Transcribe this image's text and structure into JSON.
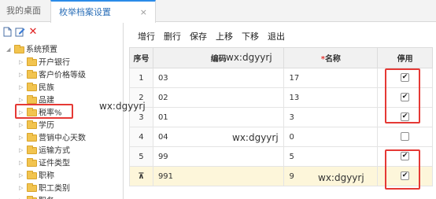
{
  "tabs": [
    {
      "label": "我的桌面"
    },
    {
      "label": "枚举档案设置",
      "close": "×"
    }
  ],
  "left_toolbar": {
    "icons": [
      "doc-icon",
      "edit-icon",
      "delete-icon"
    ],
    "delete_glyph": "✕"
  },
  "tree": {
    "root": "系统预置",
    "items": [
      "开户银行",
      "客户价格等级",
      "民族",
      "品建",
      "税率%",
      "学历",
      "营销中心天数",
      "运输方式",
      "证件类型",
      "职称",
      "职工类别",
      "职务"
    ]
  },
  "toolbar": {
    "add_row": "增行",
    "delete_row": "删行",
    "save": "保存",
    "move_up": "上移",
    "move_down": "下移",
    "exit": "退出"
  },
  "grid": {
    "headers": {
      "seq": "序号",
      "code": "编码",
      "required_mark": "*",
      "name": "名称",
      "disabled": "停用"
    },
    "rows": [
      {
        "seq": "1",
        "code": "03",
        "name": "17",
        "disabled": true
      },
      {
        "seq": "2",
        "code": "02",
        "name": "13",
        "disabled": true
      },
      {
        "seq": "3",
        "code": "01",
        "name": "3",
        "disabled": true
      },
      {
        "seq": "4",
        "code": "04",
        "name": "0",
        "disabled": false
      },
      {
        "seq": "5",
        "code": "99",
        "name": "5",
        "disabled": true
      },
      {
        "seq": "",
        "code": "991",
        "name": "9",
        "disabled": true
      }
    ],
    "check_glyph": "✔",
    "editing_row_icon": "pin-icon",
    "editing_row_glyph": "⊼"
  },
  "watermarks": [
    "wx:dgyyrj",
    "wx:dgyyrj",
    "wx:dgyyrj",
    "wx:dgyyrj"
  ],
  "colors": {
    "highlight": "#e53935",
    "tab_accent": "#2b8be8",
    "editing_row": "#fdf6da",
    "folder": "#f2c44f"
  }
}
